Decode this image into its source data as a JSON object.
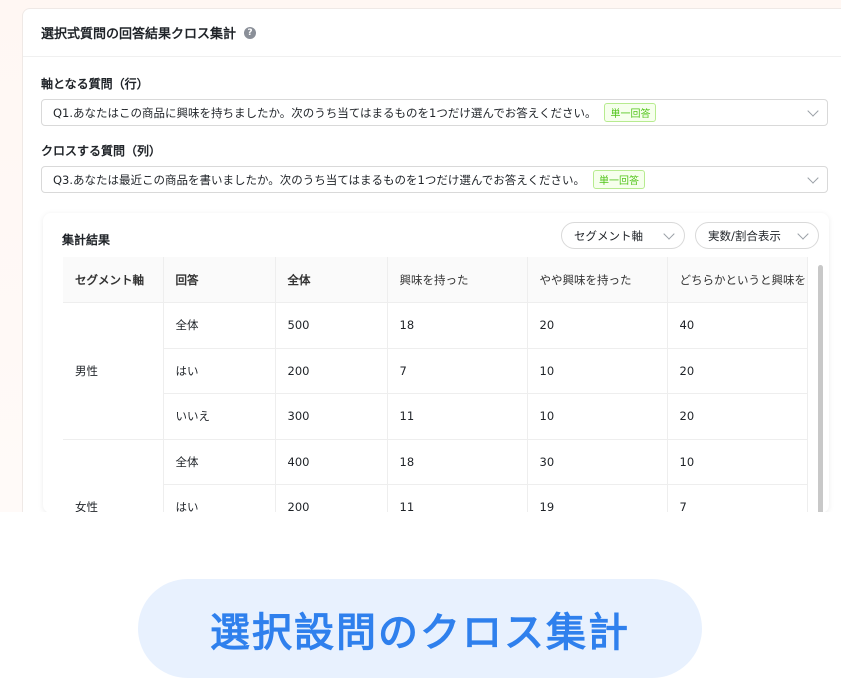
{
  "panel": {
    "title": "選択式質問の回答結果クロス集計",
    "help_icon": "?"
  },
  "row_question": {
    "label": "軸となる質問（行）",
    "value": "Q1.あなたはこの商品に興味を持ちましたか。次のうち当てはまるものを1つだけ選んでお答えください。",
    "tag": "単一回答"
  },
  "col_question": {
    "label": "クロスする質問（列）",
    "value": "Q3.あなたは最近この商品を書いましたか。次のうち当てはまるものを1つだけ選んでお答えください。",
    "tag": "単一回答"
  },
  "results": {
    "title": "集計結果",
    "segment_select": "セグメント軸",
    "display_select": "実数/割合表示",
    "headers": [
      "セグメント軸",
      "回答",
      "全体",
      "興味を持った",
      "やや興味を持った",
      "どちらかというと興味を"
    ],
    "groups": [
      {
        "segment": "男性",
        "rows": [
          [
            "全体",
            "500",
            "18",
            "20",
            "40"
          ],
          [
            "はい",
            "200",
            "7",
            "10",
            "20"
          ],
          [
            "いいえ",
            "300",
            "11",
            "10",
            "20"
          ]
        ]
      },
      {
        "segment": "女性",
        "rows": [
          [
            "全体",
            "400",
            "18",
            "30",
            "10"
          ],
          [
            "はい",
            "200",
            "11",
            "19",
            "7"
          ]
        ]
      }
    ]
  },
  "banner": {
    "text": "選択設問のクロス集計"
  },
  "colors": {
    "accent": "#2f80ed",
    "tag_green": "#52c41a",
    "banner_bg": "#e8f1fe"
  }
}
